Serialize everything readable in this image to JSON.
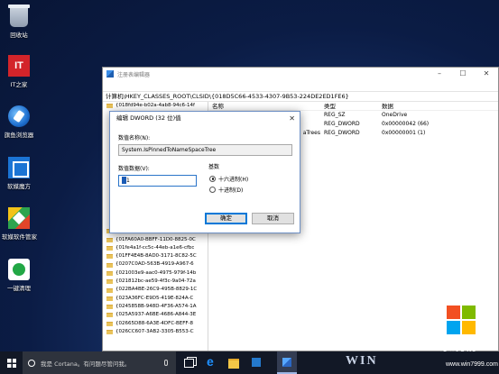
{
  "desktop": {
    "icons": [
      {
        "label": "回收站",
        "icon": "recycle-bin-icon"
      },
      {
        "label": "IT之家",
        "icon": "ithome-icon",
        "glyph": "IT"
      },
      {
        "label": "旗鱼浏览器",
        "icon": "browser-icon"
      },
      {
        "label": "软媒魔方",
        "icon": "cube-icon"
      },
      {
        "label": "软媒软件管家",
        "icon": "software-manager-icon"
      },
      {
        "label": "一键清理",
        "icon": "cleanup-icon"
      }
    ]
  },
  "regedit": {
    "title": "注册表编辑器",
    "address": "计算机\\HKEY_CLASSES_ROOT\\CLSID\\{018D5C66-4533-4307-9B53-224DE2ED1FE6}",
    "window_buttons": [
      "–",
      "☐",
      "✕"
    ],
    "tree_top": [
      "{018fd94e-b02a-4ab8-94c6-14f"
    ],
    "tree_bottom": [
      "{01F3E95C-7D8F-46e6-A408-9E",
      "{01FA60A0-BBFF-11D0-8825-0C",
      "{01fe4a1f-cc5c-44eb-a1e6-cfbc",
      "{01FF4E4B-8AD0-3171-8C82-5C",
      "{0207C0AD-563B-4919-A967-6",
      "{021003e9-aac0-4975-979f-14b",
      "{021812bc-ae59-4f3c-9a04-72a",
      "{022BA4BE-26C9-495B-8829-1C",
      "{023A36FC-E9D5-419E-824A-C",
      "{0245858B-948D-4F36-A574-1A",
      "{025A5937-A6BE-4686-A844-3E",
      "{02665D88-6A3E-4DFC-BEFF-8",
      "{026CC607-3AB2-3305-B553-C"
    ],
    "columns": {
      "name": "名称",
      "type": "类型",
      "data": "数据"
    },
    "rows": [
      {
        "name": "",
        "type": "REG_SZ",
        "data": "OneDrive"
      },
      {
        "name": "",
        "type": "REG_DWORD",
        "data": "0x00000042 (66)"
      },
      {
        "name": "aTrees",
        "type": "REG_DWORD",
        "data": "0x00000001 (1)"
      }
    ]
  },
  "dialog": {
    "title": "编辑 DWORD (32 位)值",
    "close": "✕",
    "value_name_label": "数值名称(N):",
    "value_name": "System.IsPinnedToNameSpaceTree",
    "value_data_label": "数值数据(V):",
    "value_data": "1",
    "base_label": "基数",
    "base_options": [
      {
        "label": "十六进制(H)",
        "selected": true
      },
      {
        "label": "十进制(D)",
        "selected": false
      }
    ],
    "ok_label": "确定",
    "cancel_label": "取消"
  },
  "taskbar": {
    "search_placeholder": "我是 Cortana。有问题尽管问我。",
    "items": [
      "task-view-icon",
      "edge-icon",
      "file-explorer-icon",
      "store-icon",
      "regedit-icon"
    ]
  },
  "watermark": {
    "logo_colors": [
      "#f25022",
      "#7fba00",
      "#00a4ef",
      "#ffb900"
    ],
    "text": "系统粉",
    "url": "www.win7999.com",
    "partial": "WIN"
  }
}
